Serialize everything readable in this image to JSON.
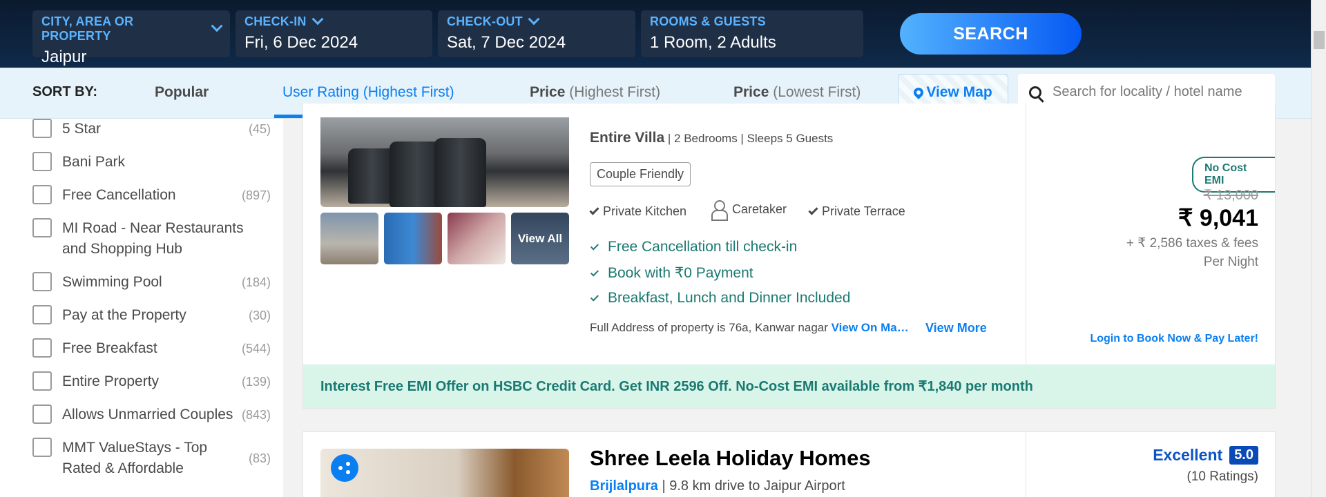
{
  "header": {
    "city": {
      "label": "CITY, AREA OR PROPERTY",
      "value": "Jaipur"
    },
    "checkin": {
      "label": "CHECK-IN",
      "value": "Fri, 6 Dec 2024"
    },
    "checkout": {
      "label": "CHECK-OUT",
      "value": "Sat, 7 Dec 2024"
    },
    "rooms": {
      "label": "ROOMS & GUESTS",
      "value": "1 Room, 2 Adults"
    },
    "search_label": "SEARCH"
  },
  "sort": {
    "title": "SORT BY:",
    "options": [
      {
        "main": "Popular",
        "sub": ""
      },
      {
        "main": "User Rating",
        "sub": "(Highest First)"
      },
      {
        "main": "Price",
        "sub": "(Highest First)"
      },
      {
        "main": "Price",
        "sub": "(Lowest First)"
      }
    ],
    "view_map": "View Map",
    "search_placeholder": "Search for locality / hotel name"
  },
  "filters": [
    {
      "label": "5 Star",
      "count": "(45)"
    },
    {
      "label": "Bani Park",
      "count": ""
    },
    {
      "label": "Free Cancellation",
      "count": "(897)"
    },
    {
      "label": "MI Road - Near Restaurants and Shopping Hub",
      "count": ""
    },
    {
      "label": "Swimming Pool",
      "count": "(184)"
    },
    {
      "label": "Pay at the Property",
      "count": "(30)"
    },
    {
      "label": "Free Breakfast",
      "count": "(544)"
    },
    {
      "label": "Entire Property",
      "count": "(139)"
    },
    {
      "label": "Allows Unmarried Couples",
      "count": "(843)"
    },
    {
      "label": "MMT ValueStays - Top Rated & Affordable",
      "count": "(83)"
    }
  ],
  "card1": {
    "view_all": "View All",
    "property_type": "Entire Villa",
    "property_details": "| 2 Bedrooms | Sleeps 5 Guests",
    "tag": "Couple Friendly",
    "amenities": [
      "Private Kitchen",
      "Caretaker",
      "Private Terrace"
    ],
    "perks": [
      "Free Cancellation till check-in",
      "Book with ₹0 Payment",
      "Breakfast, Lunch and Dinner Included"
    ],
    "address": "Full Address of property is 76a, Kanwar nagar",
    "view_on_map": "View On Ma…",
    "view_more": "View More",
    "emi_badge": "No Cost EMI",
    "old_price": "₹ 13,000",
    "price": "₹ 9,041",
    "taxes": "+ ₹ 2,586 taxes & fees",
    "per_night": "Per Night",
    "login_cta": "Login to Book Now & Pay Later!",
    "emi_offer": "Interest Free EMI Offer on HSBC Credit Card. Get INR 2596 Off. No-Cost EMI available from ₹1,840 per month"
  },
  "card2": {
    "name": "Shree Leela Holiday Homes",
    "locality": "Brijlalpura",
    "distance": "| 9.8 km drive to Jaipur Airport",
    "rating_text": "Excellent",
    "rating_score": "5.0",
    "rating_count": "(10 Ratings)"
  },
  "colors": {
    "accent": "#0a7ff2",
    "header_bg": "#0b1a2e",
    "perk_green": "#1a7971",
    "emi_bg": "#d9f5ea"
  }
}
